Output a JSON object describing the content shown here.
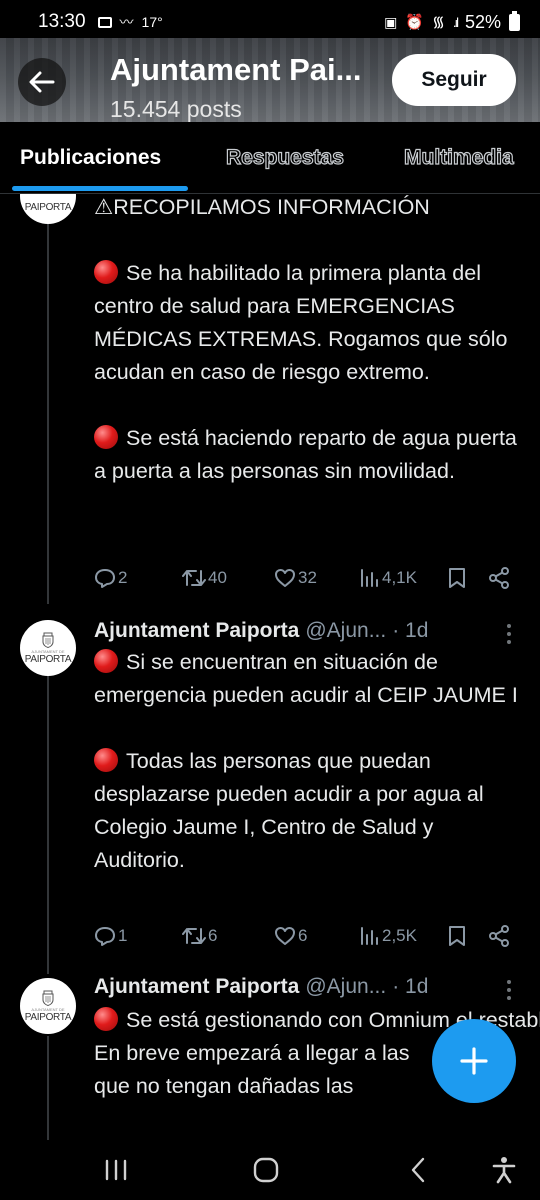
{
  "status_bar": {
    "time": "13:30",
    "temperature": "17°",
    "battery": "52%"
  },
  "header": {
    "title": "Ajuntament Pai...",
    "posts_count": "15.454 posts",
    "follow_label": "Seguir"
  },
  "tabs": [
    {
      "label": "Publicaciones",
      "active": true
    },
    {
      "label": "Respuestas",
      "active": false
    },
    {
      "label": "Multimedia",
      "active": false
    }
  ],
  "avatar": {
    "small_text": "AJUNTAMENT DE",
    "name": "PAIPORTA"
  },
  "tweets": [
    {
      "lines": [
        "⚠RECOPILAMOS INFORMACIÓN",
        "",
        "Se ha habilitado la primera planta del centro de salud para EMERGENCIAS MÉDICAS EXTREMAS. Rogamos que sólo acudan en caso de riesgo extremo.",
        "",
        "Se está haciendo reparto de agua puerta a puerta a las personas sin movilidad."
      ],
      "replies": "2",
      "reposts": "40",
      "likes": "32",
      "views": "4,1K"
    },
    {
      "author": "Ajuntament Paiporta",
      "handle": "@Ajun...",
      "time": "· 1d",
      "lines": [
        "Si se encuentran en situación de emergencia pueden acudir al CEIP JAUME I",
        "",
        "Todas las personas que puedan desplazarse pueden acudir a por agua al Colegio Jaume I, Centro de Salud y Auditorio."
      ],
      "replies": "1",
      "reposts": "6",
      "likes": "6",
      "views": "2,5K"
    },
    {
      "author": "Ajuntament Paiporta",
      "handle": "@Ajun...",
      "time": "· 1d",
      "lines": [
        "Se está gestionando con Omnium el restablecimiento de la red de",
        "En breve empezará a llegar a las",
        "que no tengan dañadas las"
      ]
    }
  ],
  "colors": {
    "accent": "#1d9bf0",
    "background": "#000000",
    "text": "#e7e9ea",
    "secondary_text": "#8b98a5"
  }
}
